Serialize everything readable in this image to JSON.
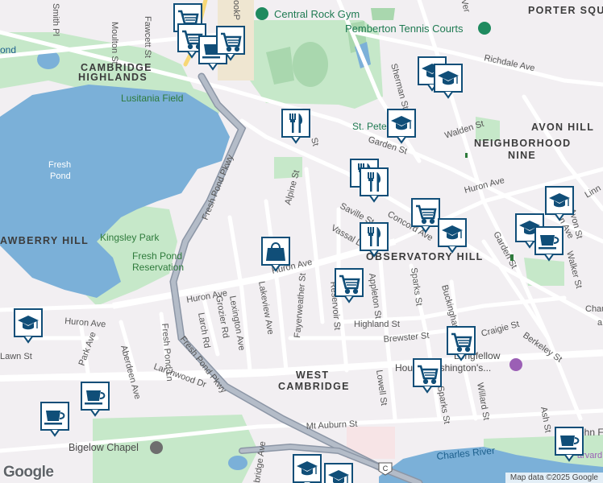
{
  "map": {
    "neighborhoods": [
      {
        "id": "porter",
        "text": "PORTER SQUA"
      },
      {
        "id": "cam-high-1",
        "text": "CAMBRIDGE"
      },
      {
        "id": "cam-high-2",
        "text": "HIGHLANDS"
      },
      {
        "id": "avon",
        "text": "AVON HILL"
      },
      {
        "id": "nn1",
        "text": "NEIGHBORHOOD"
      },
      {
        "id": "nn2",
        "text": "NINE"
      },
      {
        "id": "obs",
        "text": "OBSERVATORY HILL"
      },
      {
        "id": "straw",
        "text": "AWBERRY HILL"
      },
      {
        "id": "wc1",
        "text": "WEST"
      },
      {
        "id": "wc2",
        "text": "CAMBRIDGE"
      }
    ],
    "parks": [
      {
        "id": "lusitania",
        "text": "Lusitania Field"
      },
      {
        "id": "kingsley",
        "text": "Kingsley Park"
      },
      {
        "id": "fpr1",
        "text": "Fresh Pond"
      },
      {
        "id": "fpr2",
        "text": "Reservation"
      },
      {
        "id": "pond-top",
        "text": "ond"
      }
    ],
    "water": [
      {
        "id": "fresh-pond",
        "text": "Fresh\nPond"
      },
      {
        "id": "charles",
        "text": "Charles River"
      }
    ],
    "pois": [
      {
        "id": "rock-gym",
        "text": "Central Rock Gym",
        "icon": "pin-icon"
      },
      {
        "id": "tennis",
        "text": "Pemberton Tennis Courts",
        "icon": "pin-icon"
      },
      {
        "id": "bigelow",
        "text": "Bigelow Chapel",
        "icon": "pin-icon"
      },
      {
        "id": "longfellow1",
        "text": "Longfellow"
      },
      {
        "id": "longfellow2",
        "text": "House Washington's..."
      },
      {
        "id": "stpeter",
        "text": "St. Peter"
      },
      {
        "id": "john",
        "text": "John F"
      },
      {
        "id": "arvard",
        "text": "arvard"
      }
    ],
    "streets": [
      {
        "id": "smith",
        "text": "Smith Pl"
      },
      {
        "id": "moulton",
        "text": "Moulton St"
      },
      {
        "id": "fawcett",
        "text": "Fawcett St"
      },
      {
        "id": "richdale",
        "text": "Richdale Ave"
      },
      {
        "id": "sherman",
        "text": "Sherman St"
      },
      {
        "id": "walden",
        "text": "Walden St"
      },
      {
        "id": "garden",
        "text": "Garden St"
      },
      {
        "id": "garden2",
        "text": "Garden St"
      },
      {
        "id": "fpp1",
        "text": "Fresh Pond Pkwy"
      },
      {
        "id": "fpp2",
        "text": "Fresh Pond Pkwy"
      },
      {
        "id": "alpine",
        "text": "Alpine St"
      },
      {
        "id": "huron-e",
        "text": "Huron Ave"
      },
      {
        "id": "huron-c",
        "text": "Huron Ave"
      },
      {
        "id": "huron-w",
        "text": "Huron Ave"
      },
      {
        "id": "huron-ww",
        "text": "Huron Ave"
      },
      {
        "id": "saville",
        "text": "Saville St"
      },
      {
        "id": "concord",
        "text": "Concord Ave"
      },
      {
        "id": "vassal",
        "text": "Vassal Ln"
      },
      {
        "id": "appleton",
        "text": "Appleton St"
      },
      {
        "id": "sparks",
        "text": "Sparks St"
      },
      {
        "id": "sparks2",
        "text": "Sparks St"
      },
      {
        "id": "buckingham",
        "text": "Buckingham St"
      },
      {
        "id": "reservoir",
        "text": "Reservoir St"
      },
      {
        "id": "highland",
        "text": "Highland St"
      },
      {
        "id": "brewster",
        "text": "Brewster St"
      },
      {
        "id": "craigie",
        "text": "Craigie St"
      },
      {
        "id": "berkeley",
        "text": "Berkeley St"
      },
      {
        "id": "fayerweather",
        "text": "Fayerweather St"
      },
      {
        "id": "lakeview",
        "text": "Lakeview Ave"
      },
      {
        "id": "lexington",
        "text": "Lexington Ave"
      },
      {
        "id": "grozier",
        "text": "Grozier Rd"
      },
      {
        "id": "larch",
        "text": "Larch Rd"
      },
      {
        "id": "freshpondln",
        "text": "Fresh Pond Ln"
      },
      {
        "id": "larchwood",
        "text": "Larchwood Dr"
      },
      {
        "id": "park",
        "text": "Park Ave"
      },
      {
        "id": "aberdeen",
        "text": "Aberdeen Ave"
      },
      {
        "id": "lawn",
        "text": "Lawn St"
      },
      {
        "id": "lowell",
        "text": "Lowell St"
      },
      {
        "id": "willard",
        "text": "Willard St"
      },
      {
        "id": "ash",
        "text": "Ash St"
      },
      {
        "id": "mtauburn",
        "text": "Mt Auburn St"
      },
      {
        "id": "huron-ave-top",
        "text": "Huron Ave"
      },
      {
        "id": "walker",
        "text": "Walker St"
      },
      {
        "id": "avon-st",
        "text": "Avon St"
      },
      {
        "id": "chau",
        "text": "Chau"
      },
      {
        "id": "linn",
        "text": "Linn"
      },
      {
        "id": "bridge",
        "text": "bridge Ave"
      },
      {
        "id": "st-frag1",
        "text": "St"
      },
      {
        "id": "ro-frag",
        "text": "ookP"
      },
      {
        "id": "ver",
        "text": "Ver"
      },
      {
        "id": "route",
        "text": "3"
      },
      {
        "id": "tfrag",
        "text": "T"
      },
      {
        "id": "cfrag1",
        "text": "C"
      },
      {
        "id": "cfrag2",
        "text": "a"
      }
    ],
    "markers": [
      {
        "id": "m1",
        "icon": "shopping-cart-icon"
      },
      {
        "id": "m2",
        "icon": "shopping-cart-icon"
      },
      {
        "id": "m3",
        "icon": "coffee-cup-icon"
      },
      {
        "id": "m4",
        "icon": "shopping-cart-icon"
      },
      {
        "id": "m5",
        "icon": "graduation-cap-icon"
      },
      {
        "id": "m6",
        "icon": "graduation-cap-icon"
      },
      {
        "id": "m7",
        "icon": "restaurant-icon"
      },
      {
        "id": "m8",
        "icon": "graduation-cap-icon"
      },
      {
        "id": "m9",
        "icon": "restaurant-icon"
      },
      {
        "id": "m10",
        "icon": "restaurant-icon"
      },
      {
        "id": "m11",
        "icon": "shopping-cart-icon"
      },
      {
        "id": "m12",
        "icon": "graduation-cap-icon"
      },
      {
        "id": "m13",
        "icon": "graduation-cap-icon"
      },
      {
        "id": "m14",
        "icon": "graduation-cap-icon"
      },
      {
        "id": "m15",
        "icon": "coffee-cup-icon"
      },
      {
        "id": "m16",
        "icon": "shopping-bag-icon"
      },
      {
        "id": "m17",
        "icon": "restaurant-icon"
      },
      {
        "id": "m18",
        "icon": "shopping-cart-icon"
      },
      {
        "id": "m19",
        "icon": "shopping-cart-icon"
      },
      {
        "id": "m20",
        "icon": "shopping-cart-icon"
      },
      {
        "id": "m21",
        "icon": "graduation-cap-icon"
      },
      {
        "id": "m22",
        "icon": "coffee-cup-icon"
      },
      {
        "id": "m23",
        "icon": "coffee-cup-icon"
      },
      {
        "id": "m24",
        "icon": "coffee-cup-icon"
      },
      {
        "id": "m25",
        "icon": "graduation-cap-icon"
      },
      {
        "id": "m26",
        "icon": "graduation-cap-icon"
      }
    ]
  },
  "attribution": "Map data ©2025 Google",
  "logo": "Google",
  "colors": {
    "water": "#7bb0d8",
    "park": "#c3e6c7",
    "road": "#ffffff",
    "highway": "#9aa3b1",
    "marker": "#104e78",
    "background": "#f2eff2"
  }
}
